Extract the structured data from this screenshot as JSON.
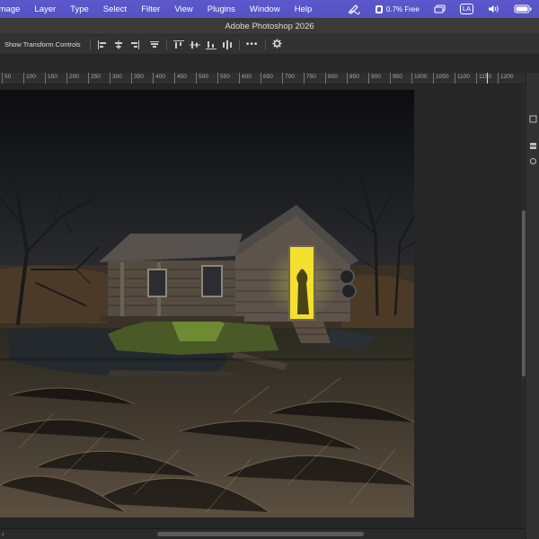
{
  "menubar": {
    "items": [
      "Image",
      "Layer",
      "Type",
      "Select",
      "Filter",
      "View",
      "Plugins",
      "Window",
      "Help"
    ],
    "memory_text": "0.7% Free",
    "language_badge": "LA",
    "icons": [
      "pen-scribble-icon",
      "memory-icon",
      "screen-mirror-icon",
      "volume-icon",
      "battery-icon"
    ]
  },
  "titlebar": {
    "title": "Adobe Photoshop 2026"
  },
  "options": {
    "show_transform_label": "Show Transform Controls",
    "more_label": "•••"
  },
  "ruler": {
    "labels": [
      "50",
      "100",
      "150",
      "200",
      "250",
      "300",
      "350",
      "400",
      "450",
      "500",
      "550",
      "600",
      "650",
      "700",
      "750",
      "800",
      "850",
      "900",
      "950",
      "1000",
      "1050",
      "1100",
      "1150",
      "1200"
    ]
  },
  "scrollbar": {
    "left_arrow": "‹"
  },
  "accent": "#5a56c8"
}
